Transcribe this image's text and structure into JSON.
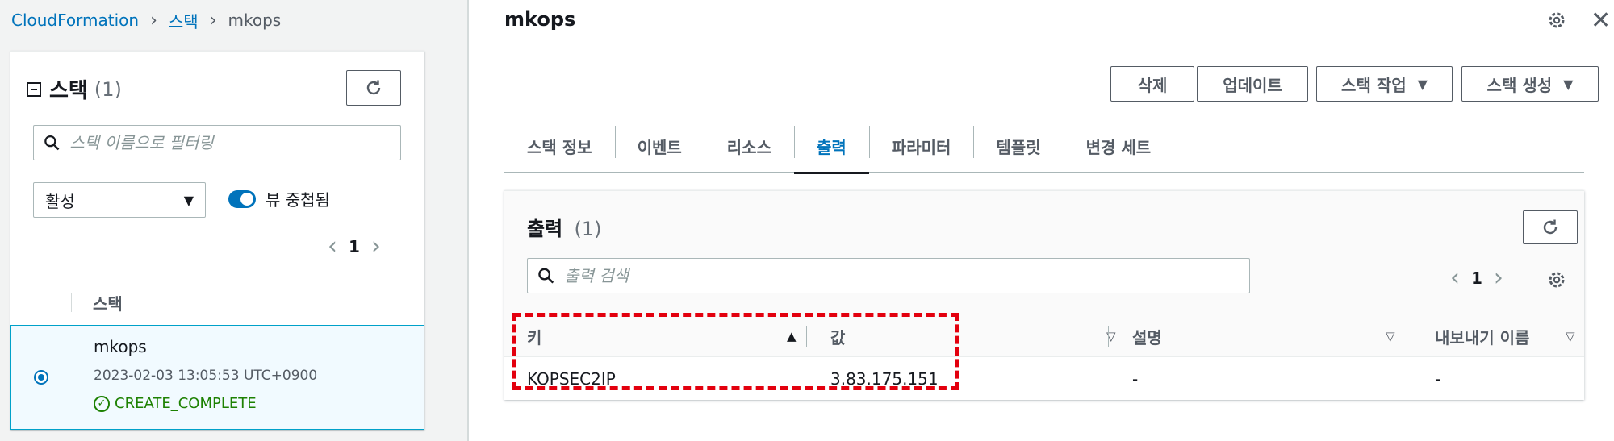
{
  "breadcrumb": {
    "root": "CloudFormation",
    "stacks": "스택",
    "current": "mkops"
  },
  "stack_panel": {
    "title": "스택",
    "count": "(1)",
    "filter_placeholder": "스택 이름으로 필터링",
    "status_filter": "활성",
    "nested_toggle_label": "뷰 중첩됨",
    "page": "1",
    "column_header": "스택",
    "rows": [
      {
        "name": "mkops",
        "created": "2023-02-03 13:05:53 UTC+0900",
        "status": "CREATE_COMPLETE"
      }
    ]
  },
  "detail": {
    "title": "mkops",
    "actions": {
      "delete": "삭제",
      "update": "업데이트",
      "stack_actions": "스택 작업",
      "create_stack": "스택 생성"
    },
    "tabs": [
      {
        "label": "스택 정보"
      },
      {
        "label": "이벤트"
      },
      {
        "label": "리소스"
      },
      {
        "label": "출력",
        "active": true
      },
      {
        "label": "파라미터"
      },
      {
        "label": "템플릿"
      },
      {
        "label": "변경 세트"
      }
    ],
    "outputs": {
      "title": "출력",
      "count": "(1)",
      "search_placeholder": "출력 검색",
      "page": "1",
      "columns": {
        "key": "키",
        "value": "값",
        "description": "설명",
        "export_name": "내보내기 이름"
      },
      "rows": [
        {
          "key": "KOPSEC2IP",
          "value": "3.83.175.151",
          "description": "-",
          "export_name": "-"
        }
      ]
    }
  },
  "colors": {
    "link": "#0073bb",
    "success": "#1d8102",
    "highlight": "#e3000e",
    "selected_row_bg": "#f1faff"
  }
}
